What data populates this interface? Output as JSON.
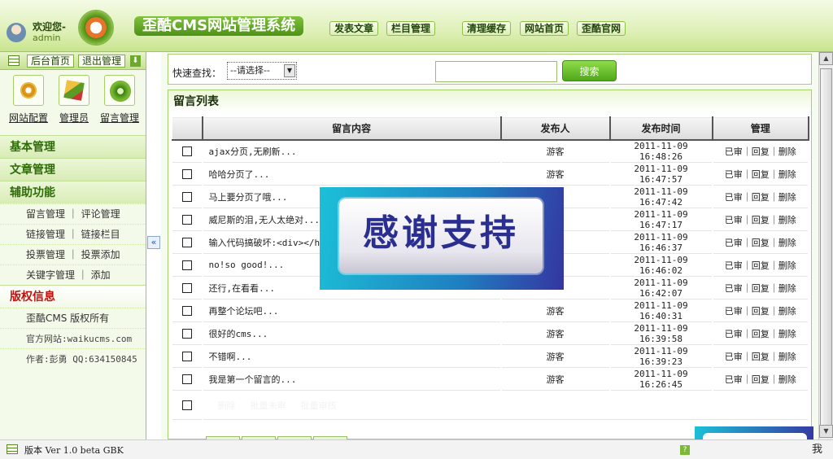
{
  "header": {
    "welcome": "欢迎您-",
    "username": "admin",
    "title": "歪酷CMS网站管理系统",
    "nav": [
      "发表文章",
      "栏目管理",
      "清理缓存",
      "网站首页",
      "歪酷官网"
    ]
  },
  "sidebar": {
    "top_buttons": [
      "后台首页",
      "退出管理"
    ],
    "quick_links": [
      "网站配置",
      "管理员",
      "留言管理"
    ],
    "sections": {
      "basic": "基本管理",
      "article": "文章管理",
      "aux": "辅助功能",
      "copyright": "版权信息"
    },
    "aux_items": [
      "留言管理 ｜ 评论管理",
      "链接管理 ｜ 链接栏目",
      "投票管理 ｜ 投票添加",
      "关键字管理 ｜ 添加"
    ],
    "copyright_items": [
      "歪酷CMS 版权所有",
      "官方网站:waikucms.com",
      "作者:彭勇 QQ:634150845"
    ],
    "collapse_glyph": "«"
  },
  "search": {
    "label": "快速查找：",
    "select_value": "--请选择--",
    "button": "搜索"
  },
  "list": {
    "title": "留言列表",
    "columns": [
      "留言内容",
      "发布人",
      "发布时间",
      "管理"
    ],
    "rows": [
      {
        "content": "ajax分页,无刷新...",
        "author": "游客",
        "time": "2011-11-09 16:48:26"
      },
      {
        "content": "哈哈分页了...",
        "author": "游客",
        "time": "2011-11-09 16:47:57"
      },
      {
        "content": "马上要分页了哦...",
        "author": "",
        "time": "2011-11-09 16:47:42"
      },
      {
        "content": "威尼斯的泪,无人太绝对...",
        "author": "",
        "time": "2011-11-09 16:47:17"
      },
      {
        "content": "输入代码搞破坏:<div></h",
        "author": "",
        "time": "2011-11-09 16:46:37"
      },
      {
        "content": "no!so good!...",
        "author": "",
        "time": "2011-11-09 16:46:02"
      },
      {
        "content": "还行,在看看...",
        "author": "",
        "time": "2011-11-09 16:42:07"
      },
      {
        "content": "再整个论坛吧...",
        "author": "游客",
        "time": "2011-11-09 16:40:31"
      },
      {
        "content": "很好的cms...",
        "author": "游客",
        "time": "2011-11-09 16:39:58"
      },
      {
        "content": "不错啊...",
        "author": "游客",
        "time": "2011-11-09 16:39:23"
      },
      {
        "content": "我是第一个留言的...",
        "author": "游客",
        "time": "2011-11-09 16:26:45"
      }
    ],
    "manage_ops": [
      "已审",
      "回复",
      "删除"
    ],
    "bulk_actions": [
      "删除",
      "批量未审",
      "批量审核"
    ]
  },
  "overlay": {
    "text": "感谢支持"
  },
  "footer": {
    "version": "版本 Ver 1.0 beta GBK",
    "help": "?",
    "more": "我"
  }
}
